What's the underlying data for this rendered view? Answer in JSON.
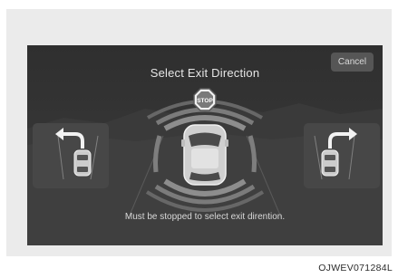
{
  "screen": {
    "title": "Select Exit Direction",
    "cancel_label": "Cancel",
    "stop_sign_text": "STOP",
    "message": "Must be stopped to select exit dirention."
  },
  "exit_options": [
    {
      "id": "left",
      "icon": "turn-left-arrow-icon"
    },
    {
      "id": "right",
      "icon": "turn-right-arrow-icon"
    }
  ],
  "figure_code": "OJWEV071284L",
  "colors": {
    "screen_bg": "#333333",
    "sensor_bars": "#8a8a8a",
    "text": "#e6e6e6"
  }
}
